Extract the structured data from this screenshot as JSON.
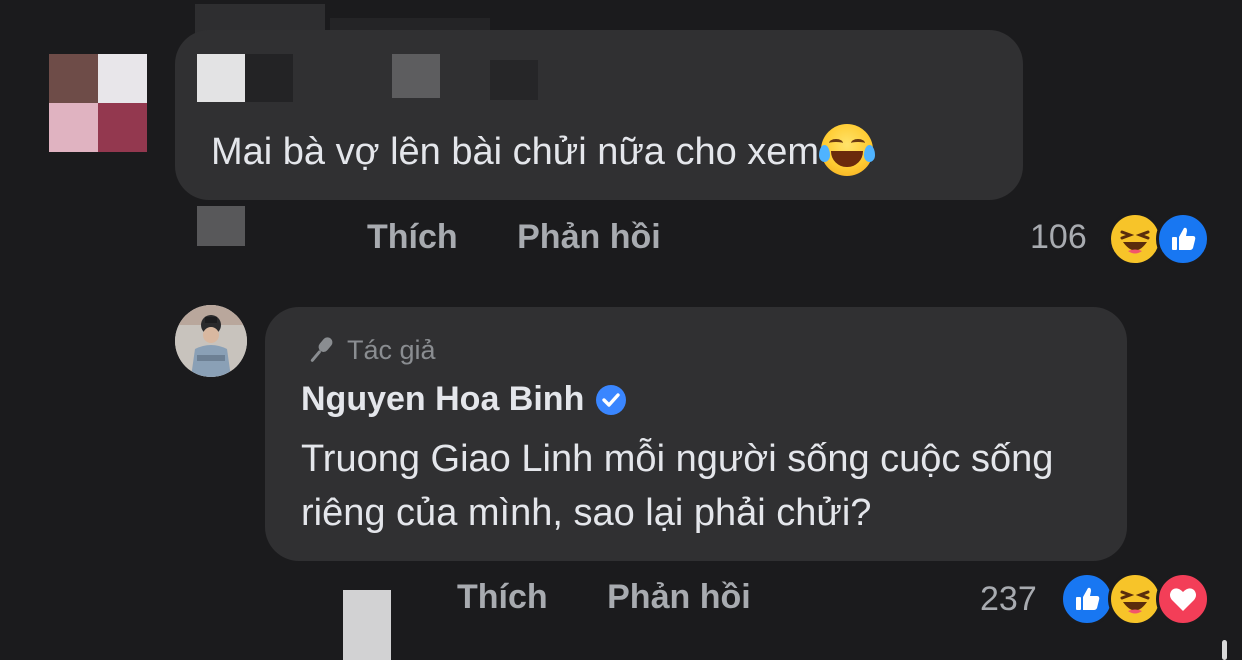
{
  "comment1": {
    "text": "Mai bà vợ lên bài chửi nữa cho xem",
    "emoji": "tears-of-joy-emoji",
    "actions": {
      "like": "Thích",
      "reply": "Phản hồi"
    },
    "reaction_count": "106",
    "reactions": [
      "haha-reaction",
      "like-reaction"
    ]
  },
  "comment2": {
    "author_badge": "Tác giả",
    "author_name": "Nguyen Hoa Binh",
    "text": "Truong Giao Linh mỗi người sống cuộc sống riêng của mình, sao lại phải chửi?",
    "actions": {
      "like": "Thích",
      "reply": "Phản hồi"
    },
    "reaction_count": "237",
    "reactions": [
      "like-reaction",
      "haha-reaction",
      "love-reaction"
    ]
  },
  "colors": {
    "background": "#1b1b1d",
    "bubble": "#303032",
    "muted_text": "#a8abb0",
    "primary_text": "#e4e6eb",
    "like_blue": "#1877f2",
    "haha_yellow": "#f7c429",
    "love_red": "#f33e58"
  }
}
